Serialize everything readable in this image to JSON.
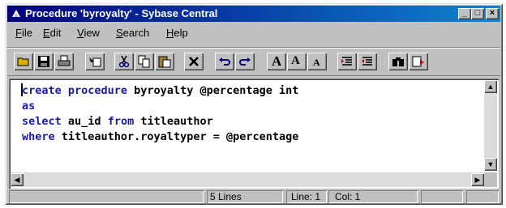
{
  "window": {
    "title": "Procedure 'byroyalty' - Sybase Central"
  },
  "menu": [
    {
      "label": "File",
      "key": "F",
      "rest": "ile"
    },
    {
      "label": "Edit",
      "key": "E",
      "rest": "dit"
    },
    {
      "label": "View",
      "key": "V",
      "rest": "iew"
    },
    {
      "label": "Search",
      "key": "S",
      "rest": "earch"
    },
    {
      "label": "Help",
      "key": "H",
      "rest": "elp"
    }
  ],
  "toolbar": {
    "font_large": "A",
    "font_increase": "A",
    "font_decrease": "A"
  },
  "editor": {
    "lines": [
      {
        "kw": "create procedure",
        "rest": " byroyalty @percentage int"
      },
      {
        "kw": "as",
        "rest": ""
      },
      {
        "kw": "select",
        "rest": " au_id ",
        "kw2": "from",
        "rest2": " titleauthor"
      },
      {
        "kw": "where",
        "rest": " titleauthor.royaltyper = @percentage"
      }
    ]
  },
  "status": {
    "lines": "5 Lines",
    "line_label": "Line: 1",
    "col_label": "Col: 1"
  },
  "colors": {
    "keyword": "#1a1aa6",
    "titlebar": "#000080"
  }
}
